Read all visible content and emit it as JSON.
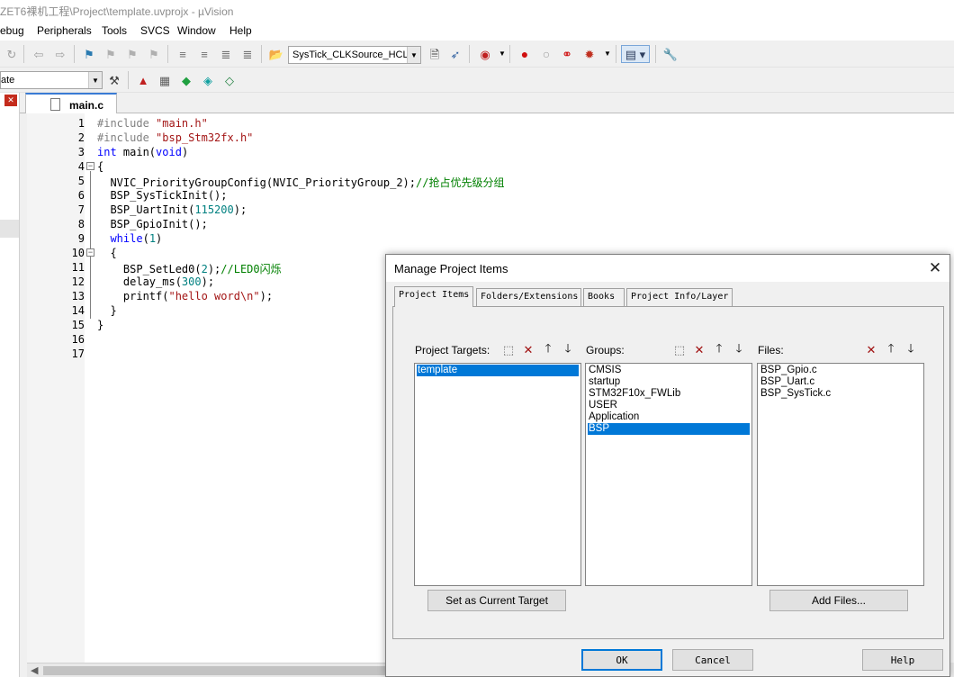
{
  "window": {
    "title": "ZET6裸机工程\\Project\\template.uvprojx - µVision"
  },
  "menu": [
    "ebug",
    "Peripherals",
    "Tools",
    "SVCS",
    "Window",
    "Help"
  ],
  "toolbar": {
    "active_symbol": "SysTick_CLKSource_HCLK",
    "target_combo": "ate"
  },
  "editor": {
    "tab_label": "main.c",
    "line_numbers": [
      "1",
      "2",
      "3",
      "4",
      "5",
      "6",
      "7",
      "8",
      "9",
      "10",
      "11",
      "12",
      "13",
      "14",
      "15",
      "16",
      "17"
    ],
    "code": {
      "l1_a": "#include ",
      "l1_b": "\"main.h\"",
      "l2_a": "#include ",
      "l2_b": "\"bsp_Stm32fx.h\"",
      "l3_a": "int",
      "l3_b": " main(",
      "l3_c": "void",
      "l3_d": ")",
      "l4": "{",
      "l5_a": "  NVIC_PriorityGroupConfig(NVIC_PriorityGroup_2);",
      "l5_b": "//抢占优先级分组",
      "l6": "  BSP_SysTickInit();",
      "l7_a": "  BSP_UartInit(",
      "l7_b": "115200",
      "l7_c": ");",
      "l8": "  BSP_GpioInit();",
      "l9_a": "  ",
      "l9_b": "while",
      "l9_c": "(",
      "l9_d": "1",
      "l9_e": ")",
      "l10": "  {",
      "l11_a": "    BSP_SetLed0(",
      "l11_b": "2",
      "l11_c": ");",
      "l11_d": "//LED0闪烁",
      "l12_a": "    delay_ms(",
      "l12_b": "300",
      "l12_c": ");",
      "l13_a": "    printf(",
      "l13_b": "\"hello word\\n\"",
      "l13_c": ");",
      "l14": "  }",
      "l15": "}"
    }
  },
  "dialog": {
    "title": "Manage Project Items",
    "tabs": [
      "Project Items",
      "Folders/Extensions",
      "Books",
      "Project Info/Layer"
    ],
    "targets_label": "Project Targets:",
    "groups_label": "Groups:",
    "files_label": "Files:",
    "targets": [
      "template"
    ],
    "groups": [
      "CMSIS",
      "startup",
      "STM32F10x_FWLib",
      "USER",
      "Application",
      "BSP"
    ],
    "files": [
      "BSP_Gpio.c",
      "BSP_Uart.c",
      "BSP_SysTick.c"
    ],
    "set_current_target": "Set as Current Target",
    "add_files": "Add Files...",
    "ok": "OK",
    "cancel": "Cancel",
    "help": "Help"
  },
  "icons": {
    "dialog_close": "✕",
    "new_item": "new-item-icon",
    "delete_item": "delete-icon",
    "move_up": "arrow-up-icon",
    "move_down": "arrow-down-icon"
  }
}
